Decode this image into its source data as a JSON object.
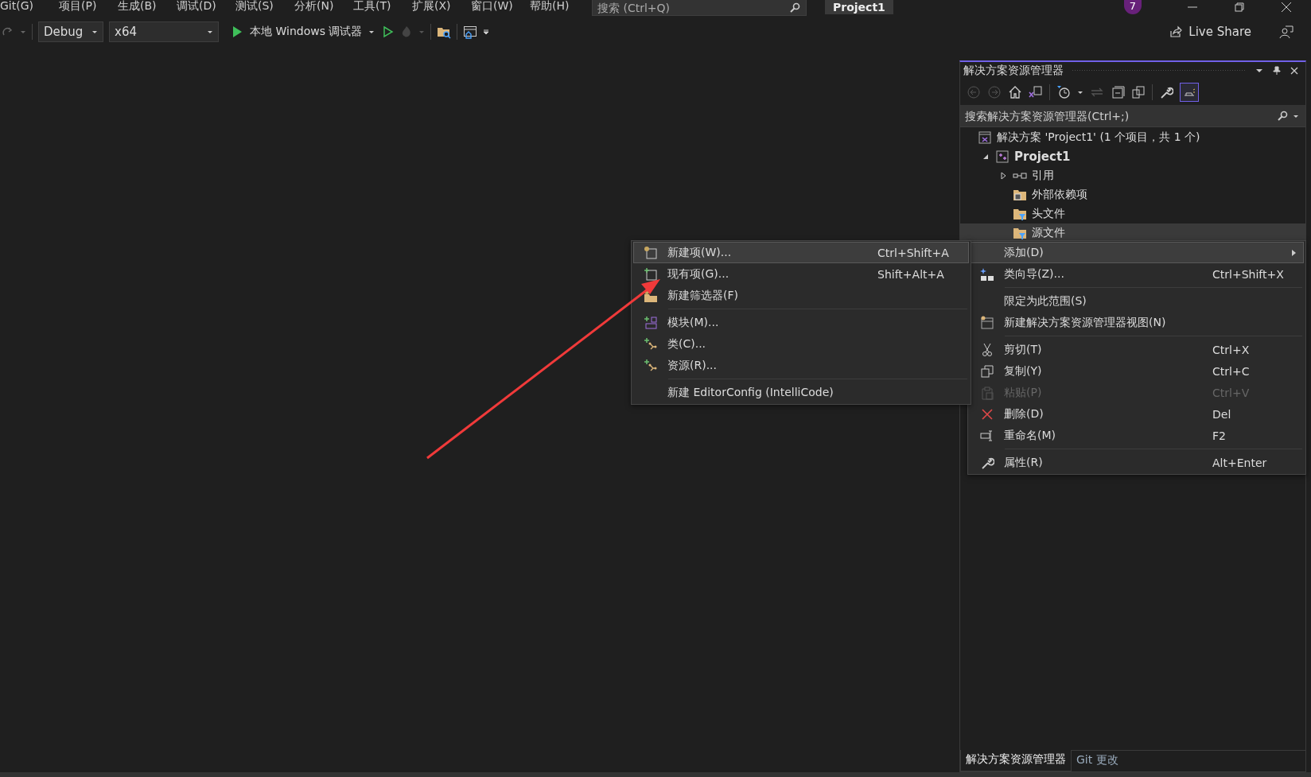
{
  "menu_bar": [
    "Git(G)",
    "项目(P)",
    "生成(B)",
    "调试(D)",
    "测试(S)",
    "分析(N)",
    "工具(T)",
    "扩展(X)",
    "窗口(W)",
    "帮助(H)"
  ],
  "search": {
    "placeholder": "搜索 (Ctrl+Q)"
  },
  "project_title": "Project1",
  "account": {
    "initial": "7"
  },
  "toolbar": {
    "configuration": "Debug",
    "platform": "x64",
    "debugger": "本地 Windows 调试器",
    "live_share": "Live Share"
  },
  "solution_explorer": {
    "title": "解决方案资源管理器",
    "preview_selected": true,
    "search": {
      "placeholder": "搜索解决方案资源管理器(Ctrl+;)"
    },
    "tree": [
      {
        "label": "解决方案 'Project1' (1 个项目，共 1 个)",
        "kind": "solution",
        "selected": false,
        "children": [
          {
            "label": "Project1",
            "kind": "project",
            "selected": false,
            "expanded": true,
            "children": [
              {
                "label": "引用",
                "kind": "references",
                "selected": false,
                "expanded": false
              },
              {
                "label": "外部依赖项",
                "kind": "external",
                "selected": false
              },
              {
                "label": "头文件",
                "kind": "filter",
                "selected": false
              },
              {
                "label": "源文件",
                "kind": "filter",
                "selected": true
              }
            ]
          }
        ]
      }
    ],
    "tabs": [
      {
        "label": "解决方案资源管理器",
        "selected": true
      },
      {
        "label": "Git 更改",
        "selected": false
      }
    ]
  },
  "context_menu": {
    "groups": [
      [
        {
          "label": "添加(D)",
          "selected": true,
          "disabled": false,
          "submenu": true
        },
        {
          "label": "类向导(Z)...",
          "shortcut": "Ctrl+Shift+X",
          "selected": false,
          "disabled": false,
          "submenu": false
        }
      ],
      [
        {
          "label": "限定为此范围(S)",
          "selected": false,
          "disabled": false,
          "submenu": false
        },
        {
          "label": "新建解决方案资源管理器视图(N)",
          "selected": false,
          "disabled": false,
          "submenu": false
        }
      ],
      [
        {
          "label": "剪切(T)",
          "shortcut": "Ctrl+X",
          "selected": false,
          "disabled": false,
          "submenu": false
        },
        {
          "label": "复制(Y)",
          "shortcut": "Ctrl+C",
          "selected": false,
          "disabled": false,
          "submenu": false
        },
        {
          "label": "粘贴(P)",
          "shortcut": "Ctrl+V",
          "selected": false,
          "disabled": true,
          "submenu": false
        },
        {
          "label": "删除(D)",
          "shortcut": "Del",
          "selected": false,
          "disabled": false,
          "submenu": false
        },
        {
          "label": "重命名(M)",
          "shortcut": "F2",
          "selected": false,
          "disabled": false,
          "submenu": false
        }
      ],
      [
        {
          "label": "属性(R)",
          "shortcut": "Alt+Enter",
          "selected": false,
          "disabled": false,
          "submenu": false
        }
      ]
    ]
  },
  "add_submenu": {
    "groups": [
      [
        {
          "label": "新建项(W)...",
          "shortcut": "Ctrl+Shift+A",
          "selected": true
        },
        {
          "label": "现有项(G)...",
          "shortcut": "Shift+Alt+A",
          "selected": false
        },
        {
          "label": "新建筛选器(F)",
          "selected": false
        }
      ],
      [
        {
          "label": "模块(M)...",
          "selected": false
        },
        {
          "label": "类(C)...",
          "selected": false
        },
        {
          "label": "资源(R)...",
          "selected": false
        }
      ],
      [
        {
          "label": "新建 EditorConfig (IntelliCode)",
          "selected": false
        }
      ]
    ]
  }
}
